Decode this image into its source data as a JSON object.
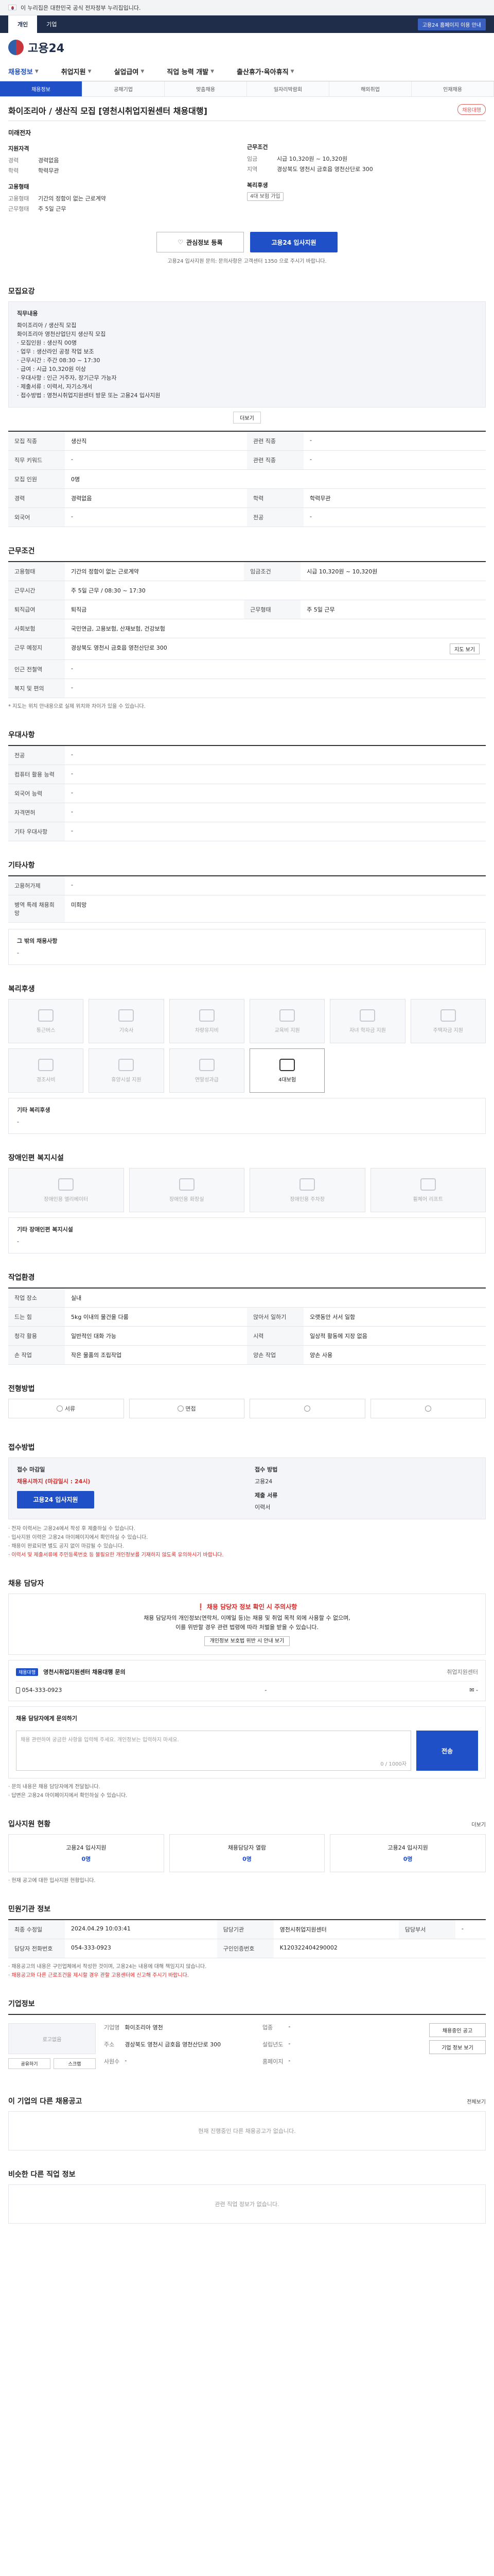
{
  "govbar": {
    "text": "이 누리집은 대한민국 공식 전자정부 누리집입니다."
  },
  "tabs": {
    "items": [
      "개인",
      "기업"
    ],
    "active": 0,
    "link": "고용24 홈페이지 이용 안내"
  },
  "logo": {
    "name": "고용24"
  },
  "gnb": {
    "items": [
      "채용정보",
      "취업지원",
      "실업급여",
      "직업 능력 개발",
      "출산휴가·육아휴직"
    ]
  },
  "subnav": {
    "items": [
      "채용정보",
      "공채기업",
      "맞춤채용",
      "일자리박람회",
      "해외취업",
      "인재채용"
    ],
    "active": 0
  },
  "job": {
    "title": "화이조리아 / 생산직 모집 [영천시취업지원센터 채용대행]",
    "badge": "채용대행"
  },
  "summary": {
    "company": "미래전자",
    "left_head": "지원자격",
    "left": [
      {
        "k": "경력",
        "v": "경력없음"
      },
      {
        "k": "학력",
        "v": "학력무관"
      }
    ],
    "right_head": "근무조건",
    "right": [
      {
        "k": "임금",
        "v": "시급 10,320원 ~ 10,320원"
      },
      {
        "k": "지역",
        "v": "경상북도 영천시 금호읍 영천산단로 300"
      }
    ],
    "form_head": "고용형태",
    "form": [
      {
        "k": "고용형태",
        "v": "기간의 정함이 없는 근로계약"
      },
      {
        "k": "근무형태",
        "v": "주 5일 근무"
      }
    ],
    "welfare_head": "복리후생",
    "welfare_tag": "4대 보험 가입"
  },
  "actions": {
    "save": "관심정보 등록",
    "apply": "고용24 입사지원"
  },
  "contact_note": "고용24 입사지원 문의: 문의사항은 고객센터 1350 으로 주시기 바랍니다.",
  "recruit": {
    "title": "모집요강",
    "box_title": "직무내용",
    "lines": [
      "화이조리아 / 생산직 모집",
      "화이조리아 영천산업단지 생산직 모집",
      "· 모집인원 : 생산직 00명",
      "· 업무 : 생산라인 공정 작업 보조",
      "· 근무시간 : 주간 08:30 ~ 17:30",
      "· 급여 : 시급 10,320원 이상",
      "· 우대사항 : 인근 거주자, 장기근무 가능자",
      "· 제출서류 : 이력서, 자기소개서",
      "· 접수방법 : 영천시취업지원센터 방문 또는 고용24 입사지원"
    ],
    "more": "더보기",
    "rows": [
      [
        {
          "k": "모집 직종",
          "v": "생산직"
        },
        {
          "k": "관련 직종",
          "v": "-"
        }
      ],
      [
        {
          "k": "직무 키워드",
          "v": "-"
        },
        {
          "k": "관련 직종",
          "v": "-"
        }
      ],
      [
        {
          "k": "모집 인원",
          "v": "0명"
        },
        {
          "k": "",
          "v": ""
        }
      ],
      [
        {
          "k": "경력",
          "v": "경력없음"
        },
        {
          "k": "학력",
          "v": "학력무관"
        }
      ],
      [
        {
          "k": "외국어",
          "v": "-"
        },
        {
          "k": "전공",
          "v": "-"
        }
      ]
    ]
  },
  "work": {
    "title": "근무조건",
    "rows": [
      [
        {
          "k": "고용형태",
          "v": "기간의 정함이 없는 근로계약"
        },
        {
          "k": "임금조건",
          "v": "시급 10,320원 ~ 10,320원"
        }
      ],
      [
        {
          "k": "근무시간",
          "v": "주 5일 근무 / 08:30 ~ 17:30"
        },
        {
          "k": "",
          "v": ""
        }
      ],
      [
        {
          "k": "퇴직급여",
          "v": "퇴직금"
        },
        {
          "k": "근무형태",
          "v": "주 5일 근무"
        }
      ],
      [
        {
          "k": "사회보험",
          "v": "국민연금, 고용보험, 산재보험, 건강보험"
        },
        {
          "k": "",
          "v": ""
        }
      ],
      [
        {
          "k": "근무 예정지",
          "v": "경상북도 영천시 금호읍 영천산단로 300"
        },
        {
          "k": "",
          "v": ""
        }
      ],
      [
        {
          "k": "인근 전철역",
          "v": "-"
        },
        {
          "k": "",
          "v": ""
        }
      ],
      [
        {
          "k": "복지 및 편의",
          "v": "-"
        },
        {
          "k": "",
          "v": ""
        }
      ]
    ],
    "map_btn": "지도 보기",
    "note": "* 지도는 위치 안내용으로 실제 위치와 차이가 있을 수 있습니다."
  },
  "prefer": {
    "title": "우대사항",
    "rows": [
      {
        "k": "전공",
        "v": "-"
      },
      {
        "k": "컴퓨터 활용 능력",
        "v": "-"
      },
      {
        "k": "외국어 능력",
        "v": "-"
      },
      {
        "k": "자격면허",
        "v": "-"
      },
      {
        "k": "기타 우대사항",
        "v": "-"
      }
    ]
  },
  "etc": {
    "title": "기타사항",
    "rows": [
      {
        "k": "고용허가제",
        "v": "-"
      },
      {
        "k": "병역 특례 채용희망",
        "v": "미희망"
      }
    ],
    "box_title": "그 밖의 채용사항",
    "box_text": "-"
  },
  "welfare": {
    "title": "복리후생",
    "icons": [
      "통근버스",
      "기숙사",
      "차량유지비",
      "교육비 지원",
      "자녀 학자금 지원",
      "주택자금 지원",
      "경조사비",
      "휴양시설 지원",
      "연말성과급",
      "4대보험",
      "",
      ""
    ],
    "active": "4대보험",
    "other_title": "기타 복리후생",
    "other_text": "-"
  },
  "disabled": {
    "title": "장애인편 복지시설",
    "icons": [
      "장애인용 엘리베이터",
      "장애인용 화장실",
      "장애인용 주차장",
      "휠체어 리프트"
    ],
    "other_title": "기타 장애인편 복지시설",
    "other_text": "-"
  },
  "env": {
    "title": "작업환경",
    "rows": [
      [
        {
          "k": "작업 장소",
          "v": "실내"
        },
        {
          "k": "",
          "v": ""
        }
      ],
      [
        {
          "k": "드는 힘",
          "v": "5kg 이내의 물건을 다룸"
        },
        {
          "k": "앉아서 일하기",
          "v": "오랫동안 서서 일함"
        }
      ],
      [
        {
          "k": "청각 활용",
          "v": "일반적인 대화 가능"
        },
        {
          "k": "시력",
          "v": "일상적 활동에 지장 없음"
        }
      ],
      [
        {
          "k": "손 작업",
          "v": "작은 물품의 조립작업"
        },
        {
          "k": "양손 작업",
          "v": "양손 사용"
        }
      ]
    ]
  },
  "process": {
    "title": "전형방법",
    "steps": [
      "서류",
      "면접",
      "",
      ""
    ]
  },
  "apply": {
    "title": "접수방법",
    "period_k": "접수 마감일",
    "period_v": "채용시까지 (마감일시 : 24시)",
    "method_k": "접수 방법",
    "method_v": "고용24",
    "button": "고용24 입사지원",
    "docs_k": "제출 서류",
    "docs_v": "이력서",
    "notes": [
      "· 전자 이력서는 고용24에서 작성 후 제출하실 수 있습니다.",
      "· 입사지원 이력은 고용24 마이페이지에서 확인하실 수 있습니다.",
      "· 채용이 완료되면 별도 공지 없이 마감될 수 있습니다.",
      "· 이력서 및 제출서류에 주민등록번호 등 불필요한 개인정보를 기재하지 않도록 유의하시기 바랍니다."
    ]
  },
  "manager": {
    "title": "채용 담당자",
    "warn_title": "채용 담당자 정보 확인 시 주의사항",
    "warn_lines": [
      "채용 담당자의 개인정보(연락처, 이메일 등)는 채용 및 취업 목적 외에 사용할 수 없으며,",
      "이를 위반할 경우 관련 법령에 따라 처벌을 받을 수 있습니다."
    ],
    "warn_btn": "개인정보 보호법 위반 시 안내 보기",
    "pill": "채용대행",
    "agency": "영천시취업지원센터 채용대행 문의",
    "agency_right": "취업지원센터",
    "phone": "054-333-0923",
    "fax": "-",
    "email": "-"
  },
  "qna": {
    "title": "채용 담당자에게 문의하기",
    "placeholder": "채용 관련하여 궁금한 사항을 입력해 주세요. 개인정보는 입력하지 마세요.",
    "count": "0 / 1000자",
    "send": "전송",
    "notes": [
      "· 문의 내용은 채용 담당자에게 전달됩니다.",
      "· 답변은 고용24 마이페이지에서 확인하실 수 있습니다."
    ]
  },
  "how": {
    "title": "입사지원 현황",
    "more": "더보기",
    "items": [
      {
        "label": "고용24 입사지원",
        "value": "0명"
      },
      {
        "label": "채용담당자 열람",
        "value": "0명"
      },
      {
        "label": "고용24 입사지원",
        "value": "0명"
      }
    ],
    "note": "· 현재 공고에 대한 입사지원 현황입니다."
  },
  "org": {
    "title": "민원기관 정보",
    "rows": [
      [
        {
          "k": "최종 수정일",
          "v": "2024.04.29 10:03:41"
        },
        {
          "k": "담당기관",
          "v": "영천시취업지원센터"
        },
        {
          "k": "담당부서",
          "v": "-"
        }
      ],
      [
        {
          "k": "담당자 전화번호",
          "v": "054-333-0923"
        },
        {
          "k": "구인인증번호",
          "v": "K120322404290002"
        },
        {
          "k": "",
          "v": ""
        }
      ]
    ],
    "notes": [
      "· 채용공고의 내용은 구인업체에서 작성한 것이며, 고용24는 내용에 대해 책임지지 않습니다.",
      "· 채용공고와 다른 근로조건을 제시할 경우 관할 고용센터에 신고해 주시기 바랍니다."
    ]
  },
  "corp": {
    "title": "기업정보",
    "logo_text": "로고없음",
    "share": [
      "공유하기",
      "스크랩"
    ],
    "info": [
      {
        "k": "기업명",
        "v": "화이조리아 영천"
      },
      {
        "k": "업종",
        "v": "-"
      },
      {
        "k": "주소",
        "v": "경상북도 영천시 금호읍 영천산단로 300"
      },
      {
        "k": "설립년도",
        "v": "-"
      },
      {
        "k": "사원수",
        "v": "-"
      },
      {
        "k": "홈페이지",
        "v": "-"
      }
    ],
    "side": [
      "채용중인 공고",
      "기업 정보 보기"
    ]
  },
  "other_jobs": {
    "title": "이 기업의 다른 채용공고",
    "empty": "현재 진행중인 다른 채용공고가 없습니다.",
    "more": "전체보기"
  },
  "similar": {
    "title": "비슷한 다른 직업 정보",
    "empty": "관련 직업 정보가 없습니다."
  }
}
